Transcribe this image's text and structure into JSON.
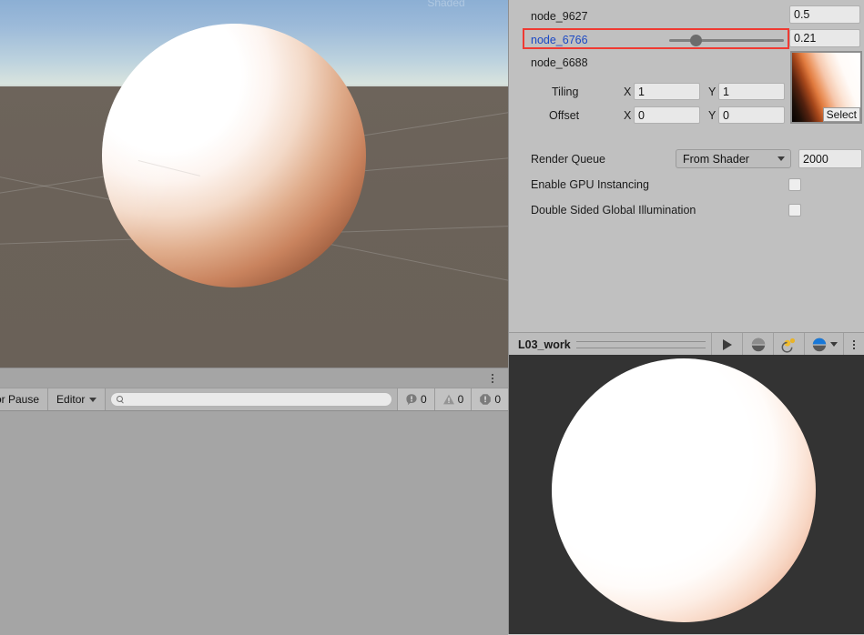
{
  "scene_view": {
    "faded_overlay_text": "Shaded",
    "sky_top_color": "#8cafd4",
    "sky_horizon_color": "#d8e3de",
    "ground_color": "#6b6259"
  },
  "console": {
    "error_pause_label": "Error Pause",
    "log_filter_label": "Editor",
    "search_placeholder": "",
    "search_value": "",
    "counts": {
      "log": "0",
      "warning": "0",
      "error": "0"
    },
    "kebab_icon": "more-options-icon"
  },
  "inspector": {
    "properties": [
      {
        "name": "node_9627",
        "value": "0.5",
        "has_slider": false,
        "highlighted": false
      },
      {
        "name": "node_6766",
        "value": "0.21",
        "has_slider": true,
        "slider_fraction": 0.25,
        "highlighted": true
      },
      {
        "name": "node_6688",
        "value": "",
        "has_slider": false,
        "highlighted": false
      }
    ],
    "texture": {
      "select_button_label": "Select",
      "tiling_label": "Tiling",
      "offset_label": "Offset",
      "x_label": "X",
      "y_label": "Y",
      "tiling_x": "1",
      "tiling_y": "1",
      "offset_x": "0",
      "offset_y": "0"
    },
    "render_queue": {
      "label": "Render Queue",
      "dropdown_value": "From Shader",
      "queue_number": "2000"
    },
    "gpu_instancing": {
      "label": "Enable GPU Instancing",
      "checked": false
    },
    "double_sided_gi": {
      "label": "Double Sided Global Illumination",
      "checked": false
    },
    "highlight_color": "#ef3a32",
    "link_color": "#1c49c4"
  },
  "material_preview": {
    "title": "L03_work",
    "buttons": [
      {
        "name": "play-button",
        "icon": "play-icon"
      },
      {
        "name": "preview-mesh-button",
        "icon": "sphere-icon"
      },
      {
        "name": "lighting-button",
        "icon": "light-icon"
      },
      {
        "name": "preview-type-button",
        "icon": "sphere-blue-icon"
      },
      {
        "name": "preview-options-button",
        "icon": "more-options-icon"
      }
    ],
    "background_color": "#333333"
  }
}
